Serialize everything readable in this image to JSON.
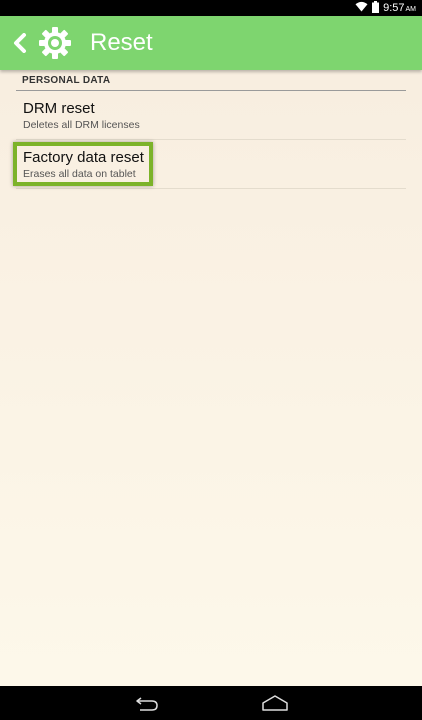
{
  "status": {
    "time": "9:57",
    "ampm": "AM",
    "wifi_icon": "wifi-icon",
    "battery_icon": "battery-icon"
  },
  "action_bar": {
    "title": "Reset",
    "color": "#7ed56f",
    "back_icon": "chevron-left-icon",
    "app_icon": "gear-icon"
  },
  "section": {
    "header": "PERSONAL DATA"
  },
  "items": [
    {
      "title": "DRM reset",
      "summary": "Deletes all DRM licenses"
    },
    {
      "title": "Factory data reset",
      "summary": "Erases all data on tablet"
    }
  ],
  "highlight": {
    "color": "#7cb32a",
    "target": "Factory data reset"
  },
  "nav": {
    "back_icon": "back-arrow-icon",
    "home_icon": "home-icon"
  }
}
